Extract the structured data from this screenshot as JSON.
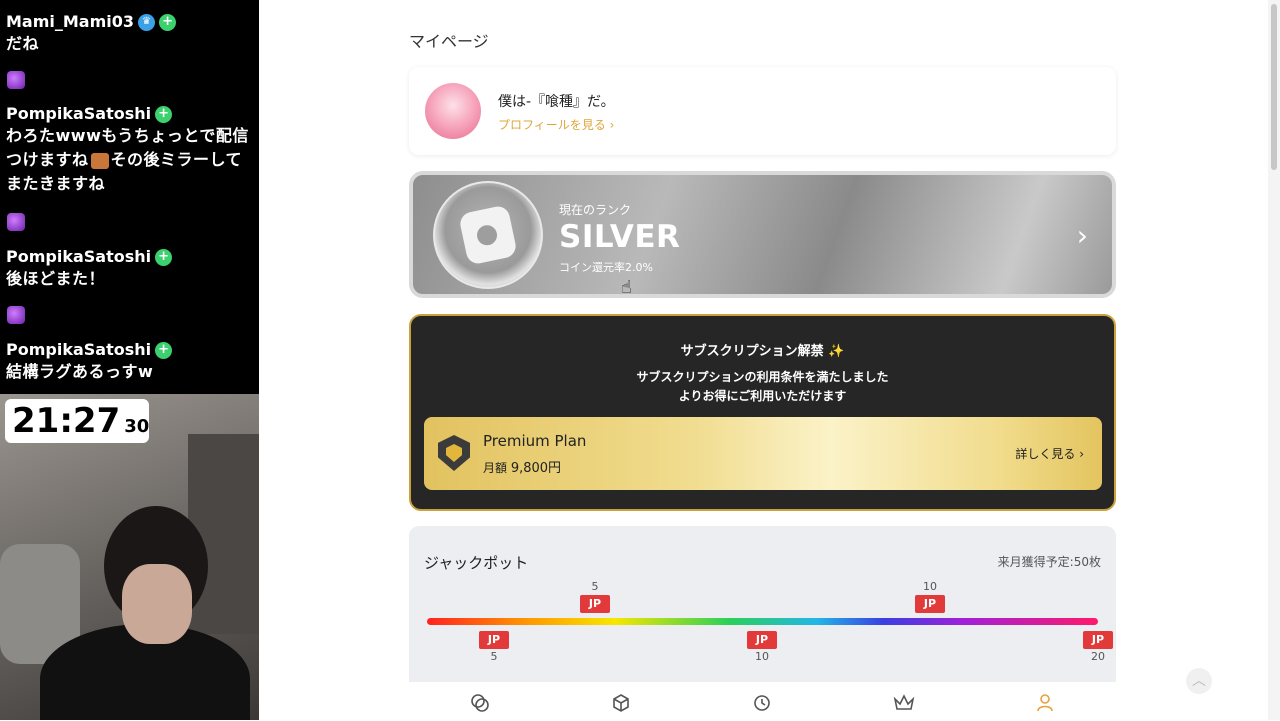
{
  "chat": {
    "messages": [
      {
        "user": "Mami_Mami03",
        "text": "だね"
      },
      {
        "user": "PompikaSatoshi",
        "text": "わろたwwwもうちょっとで配信つけますね",
        "text2": "その後ミラーしてまたきますね"
      },
      {
        "user": "PompikaSatoshi",
        "text": "後ほどまた！"
      },
      {
        "user": "PompikaSatoshi",
        "text": "結構ラグあるっすw"
      }
    ]
  },
  "clock": {
    "hm": "21:27",
    "sec": "30"
  },
  "page": {
    "title": "マイページ"
  },
  "profile": {
    "name": "僕は-『喰種』だ。",
    "link": "プロフィールを見る ›"
  },
  "rank": {
    "label": "現在のランク",
    "name": "SILVER",
    "rate": "コイン還元率2.0%",
    "chevron": "›"
  },
  "subscription": {
    "title": "サブスクリプション解禁 ✨",
    "desc1": "サブスクリプションの利用条件を満たしました",
    "desc2": "よりお得にご利用いただけます",
    "plan_name": "Premium Plan",
    "price_label": "月額",
    "price_value": "9,800円",
    "more": "詳しく見る ›"
  },
  "jackpot": {
    "title": "ジャックポット",
    "next_month": "来月獲得予定:50枚",
    "badge_label": "JP",
    "top_nums": [
      "5",
      "10"
    ],
    "bottom_nums": [
      "5",
      "10",
      "20"
    ]
  },
  "nav": {
    "icons": [
      "coins-icon",
      "box-icon",
      "history-icon",
      "crown-icon",
      "user-icon"
    ]
  },
  "colors": {
    "rank_silver": "#9a9a9a",
    "subscription_bg": "#262626",
    "subscription_border": "#c9a23c",
    "premium_gold": "#f1dd90",
    "accent_link": "#e0a63a",
    "jp_badge": "#e23a3a",
    "nav_active": "#e6a23c"
  }
}
